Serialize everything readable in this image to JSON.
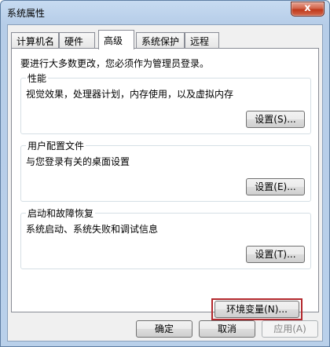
{
  "window": {
    "title": "系统属性",
    "close_glyph": "x"
  },
  "tabs": [
    {
      "label": "计算机名"
    },
    {
      "label": "硬件"
    },
    {
      "label": "高级"
    },
    {
      "label": "系统保护"
    },
    {
      "label": "远程"
    }
  ],
  "active_tab": "高级",
  "advanced": {
    "intro": "要进行大多数更改，您必须作为管理员登录。",
    "performance": {
      "title": "性能",
      "description": "视觉效果，处理器计划，内存使用，以及虚拟内存",
      "button": "设置(S)..."
    },
    "user_profiles": {
      "title": "用户配置文件",
      "description": "与您登录有关的桌面设置",
      "button": "设置(E)..."
    },
    "startup_recovery": {
      "title": "启动和故障恢复",
      "description": "系统启动、系统失败和调试信息",
      "button": "设置(T)..."
    },
    "env_button": "环境变量(N)..."
  },
  "footer": {
    "ok": "确定",
    "cancel": "取消",
    "apply": "应用(A)"
  },
  "colors": {
    "highlight_border": "#b3282d",
    "close_button": "#c0391b"
  }
}
